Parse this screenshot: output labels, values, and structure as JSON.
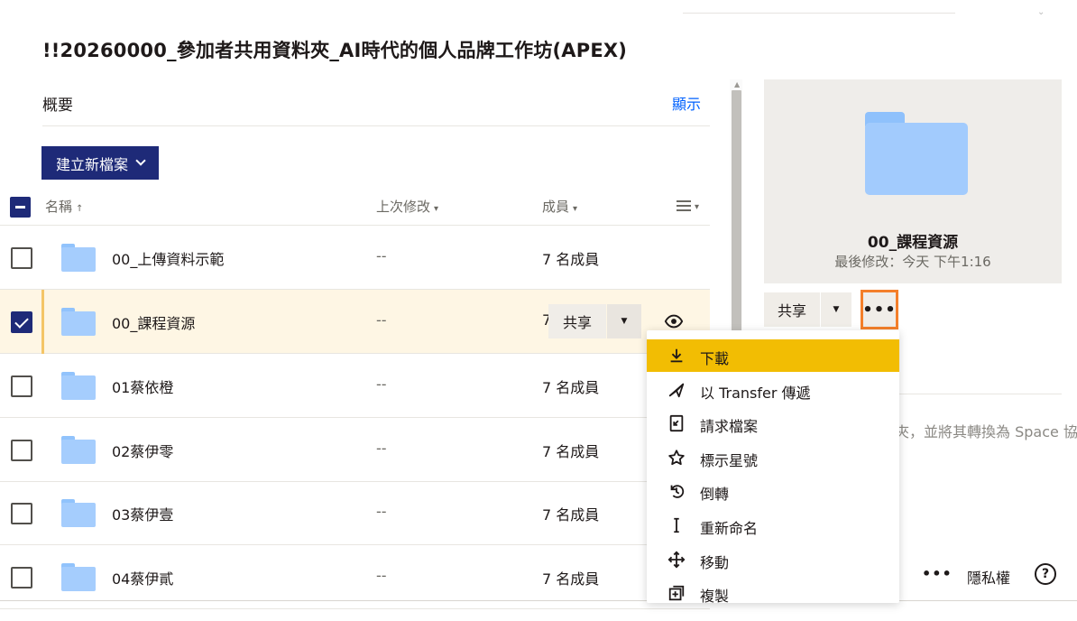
{
  "page": {
    "title": "!!20260000_參加者共用資料夾_AI時代的個人品牌工作坊(APEX)"
  },
  "overview": {
    "label": "概要",
    "toggle": "顯示"
  },
  "toolbar": {
    "create_label": "建立新檔案"
  },
  "table": {
    "columns": {
      "name": "名稱",
      "modified": "上次修改",
      "members": "成員"
    },
    "rows": [
      {
        "name": "00_上傳資料示範",
        "modified": "--",
        "members": "7 名成員",
        "selected": false
      },
      {
        "name": "00_課程資源",
        "modified": "--",
        "members": "7",
        "selected": true
      },
      {
        "name": "01蔡依橙",
        "modified": "--",
        "members": "7 名成員",
        "selected": false
      },
      {
        "name": "02蔡伊零",
        "modified": "--",
        "members": "7 名成員",
        "selected": false
      },
      {
        "name": "03蔡伊壹",
        "modified": "--",
        "members": "7 名成員",
        "selected": false
      },
      {
        "name": "04蔡伊貳",
        "modified": "--",
        "members": "7 名成員",
        "selected": false
      }
    ],
    "row_share_label": "共享"
  },
  "preview": {
    "name": "00_課程資源",
    "modified": "最後修改：今天 下午1:16",
    "share_label": "共享",
    "more_label": "•••",
    "side_text": "夾，並將其轉換為 Space 協"
  },
  "context_menu": {
    "items": [
      {
        "label": "下載",
        "icon": "download-icon",
        "active": true
      },
      {
        "label": "以 Transfer 傳遞",
        "icon": "send-icon",
        "active": false
      },
      {
        "label": "請求檔案",
        "icon": "file-request-icon",
        "active": false
      },
      {
        "label": "標示星號",
        "icon": "star-icon",
        "active": false
      },
      {
        "label": "倒轉",
        "icon": "rewind-icon",
        "active": false
      },
      {
        "label": "重新命名",
        "icon": "rename-icon",
        "active": false
      },
      {
        "label": "移動",
        "icon": "move-icon",
        "active": false
      },
      {
        "label": "複製",
        "icon": "copy-icon",
        "active": false
      }
    ]
  },
  "footer": {
    "more": "•••",
    "privacy": "隱私權",
    "help": "?"
  },
  "colors": {
    "primary": "#1e2a78",
    "accent": "#f2bd03",
    "highlight_border": "#f47f2a",
    "selected_row": "#fef6e4",
    "folder": "#a5cdfd",
    "link": "#0061fe"
  }
}
